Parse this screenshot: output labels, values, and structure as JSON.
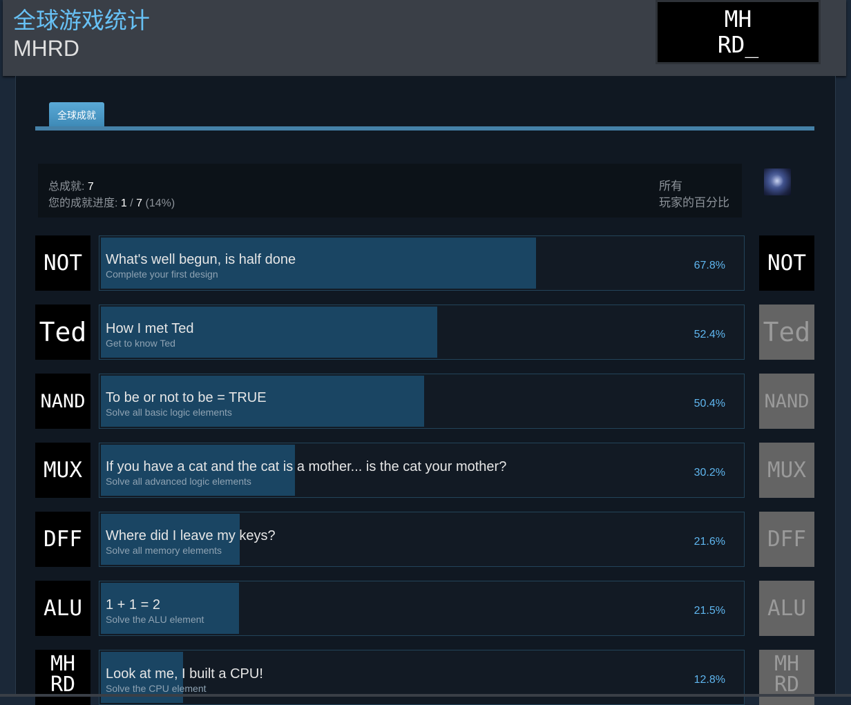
{
  "header": {
    "title": "全球游戏统计",
    "game_name": "MHRD",
    "logo_text": "MH\nRD̲"
  },
  "tabs": [
    {
      "label": "全球成就",
      "active": true
    }
  ],
  "summary": {
    "total_label": "总成就:",
    "total_value": "7",
    "progress_label": "您的成就进度:",
    "progress_current": "1",
    "progress_sep": "/",
    "progress_total": "7",
    "progress_percent": "(14%)",
    "column_header_line1": "所有",
    "column_header_line2": "玩家的百分比"
  },
  "colors": {
    "accent": "#67c1f5",
    "bar_fill": "#1a4563",
    "percent_text": "#5fb6ef",
    "tab": "#4581a8"
  },
  "achievements": [
    {
      "icon_text": "NOT",
      "name": "What's well begun, is half done",
      "desc": "Complete your first design",
      "percent": "67.8%",
      "value": 67.8,
      "unlocked": true
    },
    {
      "icon_text": "Ted",
      "name": "How I met Ted",
      "desc": "Get to know Ted",
      "percent": "52.4%",
      "value": 52.4,
      "unlocked": false
    },
    {
      "icon_text": "NAND",
      "name": "To be or not to be = TRUE",
      "desc": "Solve all basic logic elements",
      "percent": "50.4%",
      "value": 50.4,
      "unlocked": false
    },
    {
      "icon_text": "MUX",
      "name": "If you have a cat and the cat is a mother... is the cat your mother?",
      "desc": "Solve all advanced logic elements",
      "percent": "30.2%",
      "value": 30.2,
      "unlocked": false
    },
    {
      "icon_text": "DFF",
      "name": "Where did I leave my keys?",
      "desc": "Solve all memory elements",
      "percent": "21.6%",
      "value": 21.6,
      "unlocked": false
    },
    {
      "icon_text": "ALU",
      "name": "1 + 1 = 2",
      "desc": "Solve the ALU element",
      "percent": "21.5%",
      "value": 21.5,
      "unlocked": false
    },
    {
      "icon_text": "MH\nRD",
      "name": "Look at me, I built a CPU!",
      "desc": "Solve the CPU element",
      "percent": "12.8%",
      "value": 12.8,
      "unlocked": false
    }
  ]
}
